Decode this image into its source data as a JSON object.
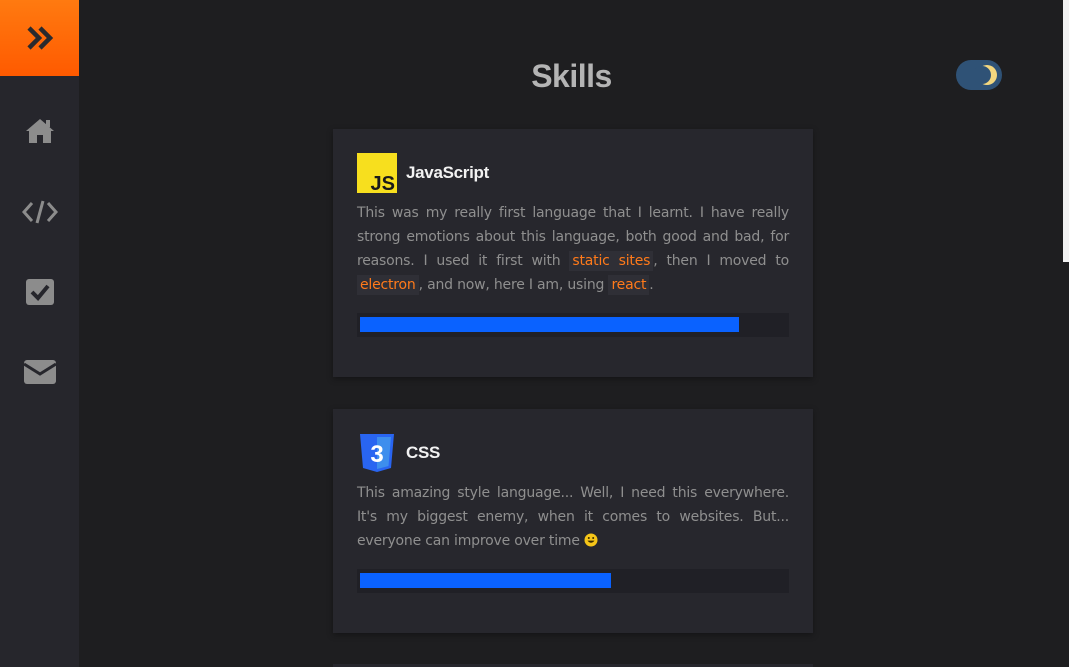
{
  "page": {
    "title": "Skills"
  },
  "colors": {
    "accent": "#ff6a00",
    "progress": "#0a62ff",
    "background": "#1e1e20",
    "sidebar": "#26262c",
    "card": "#27272d",
    "toggle": "#2f5276",
    "moon": "#f3d77f"
  },
  "sidebar": {
    "logo_icon": "double-chevron-right-icon",
    "items": [
      {
        "name": "home",
        "icon": "home-icon"
      },
      {
        "name": "code",
        "icon": "code-icon"
      },
      {
        "name": "tasks",
        "icon": "check-square-icon"
      },
      {
        "name": "contact",
        "icon": "envelope-icon"
      }
    ]
  },
  "theme_toggle": {
    "icon": "moon-icon",
    "state": "dark"
  },
  "skills": [
    {
      "name": "JavaScript",
      "logo_text": "JS",
      "desc_1": "This was my really first language that I learnt. I have really strong emotions about this language, both good and bad, for reasons. I used it first with ",
      "link_1": "static sites",
      "desc_2": ", then I moved to ",
      "link_2": "electron",
      "desc_3": ", and now, here I am, using ",
      "link_3": "react",
      "desc_4": ".",
      "progress": 0.89
    },
    {
      "name": "CSS",
      "logo_text": "3",
      "desc_1": "This amazing style language... Well, I need this everywhere. It's my biggest enemy, when it comes to websites. But... everyone can improve over time ",
      "emoji": "smiley-icon",
      "progress": 0.59
    }
  ]
}
